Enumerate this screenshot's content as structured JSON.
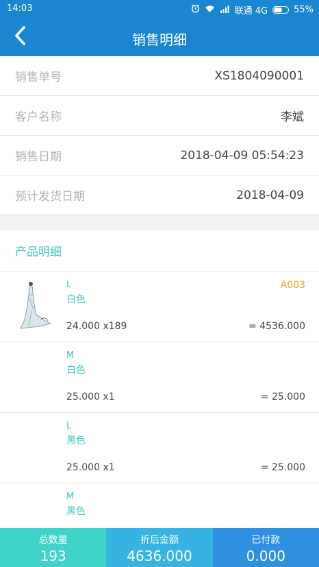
{
  "status_bar": {
    "time": "14:03",
    "carrier": "联通 4G",
    "battery": "55%",
    "battery_level": 0.55,
    "icons": [
      "alarm-icon",
      "wifi-icon",
      "signal-icon",
      "battery-icon"
    ]
  },
  "header": {
    "title": "销售明细",
    "back_icon": "chevron-left-icon"
  },
  "info": [
    {
      "label": "销售单号",
      "value": "XS1804090001"
    },
    {
      "label": "客户名称",
      "value": "李斌"
    },
    {
      "label": "销售日期",
      "value": "2018-04-09 05:54:23"
    },
    {
      "label": "预计发货日期",
      "value": "2018-04-09"
    }
  ],
  "products": {
    "title": "产品明细",
    "items": [
      {
        "size": "L",
        "color": "白色",
        "code": "A003",
        "qty": "24.000 x189",
        "amount": "= 4536.000",
        "has_image": true
      },
      {
        "size": "M",
        "color": "白色",
        "code": "",
        "qty": "25.000 x1",
        "amount": "= 25.000",
        "has_image": false
      },
      {
        "size": "L",
        "color": "黑色",
        "code": "",
        "qty": "25.000 x1",
        "amount": "= 25.000",
        "has_image": false
      },
      {
        "size": "M",
        "color": "黑色",
        "code": "",
        "qty": "",
        "amount": "",
        "has_image": false
      }
    ]
  },
  "summary": {
    "total_qty_label": "总数量",
    "total_qty": "193",
    "discount_label": "折后金额",
    "discount_amount": "4636.000",
    "paid_label": "已付款",
    "paid_amount": "0.000"
  },
  "colors": {
    "primary": "#1a86d1",
    "accent": "#3cc7c2",
    "code": "#f0a020",
    "summary_1": "#3fd3cc",
    "summary_2": "#36b3e0",
    "summary_3": "#2f8fe0"
  }
}
